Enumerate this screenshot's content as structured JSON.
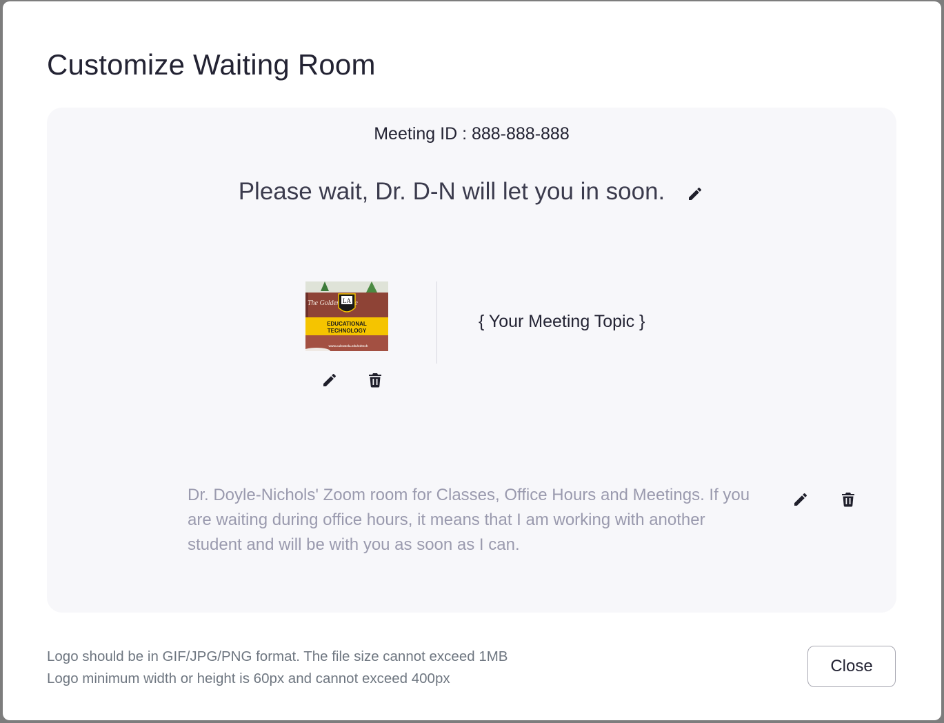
{
  "dialog": {
    "title": "Customize Waiting Room",
    "close_label": "Close"
  },
  "preview": {
    "meeting_id": "Meeting ID : 888-888-888",
    "waiting_title": "Please wait, Dr. D-N will let you in soon.",
    "topic": "{ Your Meeting Topic }",
    "description": "Dr. Doyle-Nichols' Zoom room for Classes, Office Hours and Meetings. If you are waiting during office hours, it means that I am working with another student and will be with you as soon as I can.",
    "logo": {
      "banner_line1": "EDUCATIONAL",
      "banner_line2": "TECHNOLOGY",
      "sign_text": "The Golden Eagle",
      "badge_text": "LA",
      "url_text": "www.calstatela.edu/edtech"
    }
  },
  "notes": {
    "line1": "Logo should be in GIF/JPG/PNG format. The file size cannot exceed 1MB",
    "line2": "Logo minimum width or height is 60px and cannot exceed 400px"
  },
  "icons": {
    "edit": "pencil-icon",
    "delete": "trash-icon"
  },
  "colors": {
    "preview_background": "#f7f7fa",
    "logo_banner": "#f5c400",
    "description_text": "#9a9aae"
  }
}
